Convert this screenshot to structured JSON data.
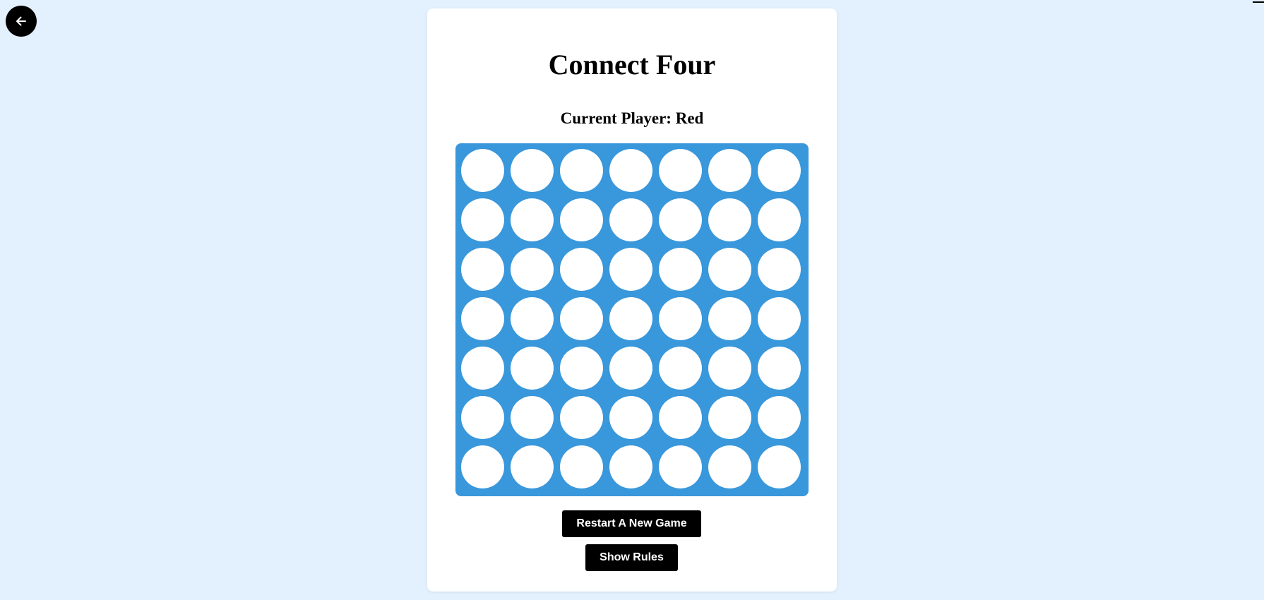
{
  "game": {
    "title": "Connect Four",
    "status_prefix": "Current Player:",
    "current_player": "Red",
    "board": {
      "rows": 7,
      "columns": 7,
      "cells": [
        [
          "empty",
          "empty",
          "empty",
          "empty",
          "empty",
          "empty",
          "empty"
        ],
        [
          "empty",
          "empty",
          "empty",
          "empty",
          "empty",
          "empty",
          "empty"
        ],
        [
          "empty",
          "empty",
          "empty",
          "empty",
          "empty",
          "empty",
          "empty"
        ],
        [
          "empty",
          "empty",
          "empty",
          "empty",
          "empty",
          "empty",
          "empty"
        ],
        [
          "empty",
          "empty",
          "empty",
          "empty",
          "empty",
          "empty",
          "empty"
        ],
        [
          "empty",
          "empty",
          "empty",
          "empty",
          "empty",
          "empty",
          "empty"
        ],
        [
          "empty",
          "empty",
          "empty",
          "empty",
          "empty",
          "empty",
          "empty"
        ]
      ]
    }
  },
  "buttons": {
    "restart_label": "Restart A New Game",
    "rules_label": "Show Rules"
  },
  "nav": {
    "back_icon": "arrow-left-icon"
  },
  "colors": {
    "page_background": "#e3f0fe",
    "board": "#3997db",
    "empty_cell": "#ffffff",
    "button": "#000000",
    "red_piece": "#e53935",
    "yellow_piece": "#fdd835"
  }
}
